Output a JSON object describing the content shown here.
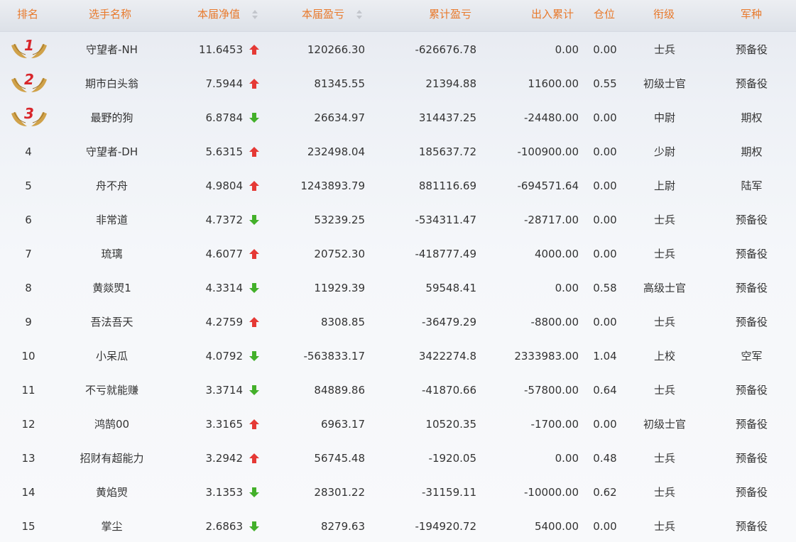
{
  "header": {
    "rank": "排名",
    "name": "选手名称",
    "nav": "本届净值",
    "pnl": "本届盈亏",
    "cum": "累计盈亏",
    "flow": "出入累计",
    "pos": "仓位",
    "rank_title": "衔级",
    "branch": "军种"
  },
  "colors": {
    "header_text": "#e8792b",
    "up": "#e53935",
    "down": "#43b02a",
    "medal": "#d0a24a",
    "medal_number": "#d8262b"
  },
  "rows": [
    {
      "rank": "1",
      "name": "守望者-NH",
      "nav": "11.6453",
      "trend": "up",
      "pnl": "120266.30",
      "cum": "-626676.78",
      "flow": "0.00",
      "pos": "0.00",
      "rank_title": "士兵",
      "branch": "预备役"
    },
    {
      "rank": "2",
      "name": "期市白头翁",
      "nav": "7.5944",
      "trend": "up",
      "pnl": "81345.55",
      "cum": "21394.88",
      "flow": "11600.00",
      "pos": "0.55",
      "rank_title": "初级士官",
      "branch": "预备役"
    },
    {
      "rank": "3",
      "name": "最野的狗",
      "nav": "6.8784",
      "trend": "down",
      "pnl": "26634.97",
      "cum": "314437.25",
      "flow": "-24480.00",
      "pos": "0.00",
      "rank_title": "中尉",
      "branch": "期权"
    },
    {
      "rank": "4",
      "name": "守望者-DH",
      "nav": "5.6315",
      "trend": "up",
      "pnl": "232498.04",
      "cum": "185637.72",
      "flow": "-100900.00",
      "pos": "0.00",
      "rank_title": "少尉",
      "branch": "期权"
    },
    {
      "rank": "5",
      "name": "舟不舟",
      "nav": "4.9804",
      "trend": "up",
      "pnl": "1243893.79",
      "cum": "881116.69",
      "flow": "-694571.64",
      "pos": "0.00",
      "rank_title": "上尉",
      "branch": "陆军"
    },
    {
      "rank": "6",
      "name": "非常道",
      "nav": "4.7372",
      "trend": "down",
      "pnl": "53239.25",
      "cum": "-534311.47",
      "flow": "-28717.00",
      "pos": "0.00",
      "rank_title": "士兵",
      "branch": "预备役"
    },
    {
      "rank": "7",
      "name": "琉璃",
      "nav": "4.6077",
      "trend": "up",
      "pnl": "20752.30",
      "cum": "-418777.49",
      "flow": "4000.00",
      "pos": "0.00",
      "rank_title": "士兵",
      "branch": "预备役"
    },
    {
      "rank": "8",
      "name": "黄燚焽1",
      "nav": "4.3314",
      "trend": "down",
      "pnl": "11929.39",
      "cum": "59548.41",
      "flow": "0.00",
      "pos": "0.58",
      "rank_title": "高级士官",
      "branch": "预备役"
    },
    {
      "rank": "9",
      "name": "吾法吾天",
      "nav": "4.2759",
      "trend": "up",
      "pnl": "8308.85",
      "cum": "-36479.29",
      "flow": "-8800.00",
      "pos": "0.00",
      "rank_title": "士兵",
      "branch": "预备役"
    },
    {
      "rank": "10",
      "name": "小呆瓜",
      "nav": "4.0792",
      "trend": "down",
      "pnl": "-563833.17",
      "cum": "3422274.8",
      "flow": "2333983.00",
      "pos": "1.04",
      "rank_title": "上校",
      "branch": "空军"
    },
    {
      "rank": "11",
      "name": "不亏就能赚",
      "nav": "3.3714",
      "trend": "down",
      "pnl": "84889.86",
      "cum": "-41870.66",
      "flow": "-57800.00",
      "pos": "0.64",
      "rank_title": "士兵",
      "branch": "预备役"
    },
    {
      "rank": "12",
      "name": "鸿鹄00",
      "nav": "3.3165",
      "trend": "up",
      "pnl": "6963.17",
      "cum": "10520.35",
      "flow": "-1700.00",
      "pos": "0.00",
      "rank_title": "初级士官",
      "branch": "预备役"
    },
    {
      "rank": "13",
      "name": "招财有超能力",
      "nav": "3.2942",
      "trend": "up",
      "pnl": "56745.48",
      "cum": "-1920.05",
      "flow": "0.00",
      "pos": "0.48",
      "rank_title": "士兵",
      "branch": "预备役"
    },
    {
      "rank": "14",
      "name": "黄焰焽",
      "nav": "3.1353",
      "trend": "down",
      "pnl": "28301.22",
      "cum": "-31159.11",
      "flow": "-10000.00",
      "pos": "0.62",
      "rank_title": "士兵",
      "branch": "预备役"
    },
    {
      "rank": "15",
      "name": "掌尘",
      "nav": "2.6863",
      "trend": "down",
      "pnl": "8279.63",
      "cum": "-194920.72",
      "flow": "5400.00",
      "pos": "0.00",
      "rank_title": "士兵",
      "branch": "预备役"
    }
  ]
}
